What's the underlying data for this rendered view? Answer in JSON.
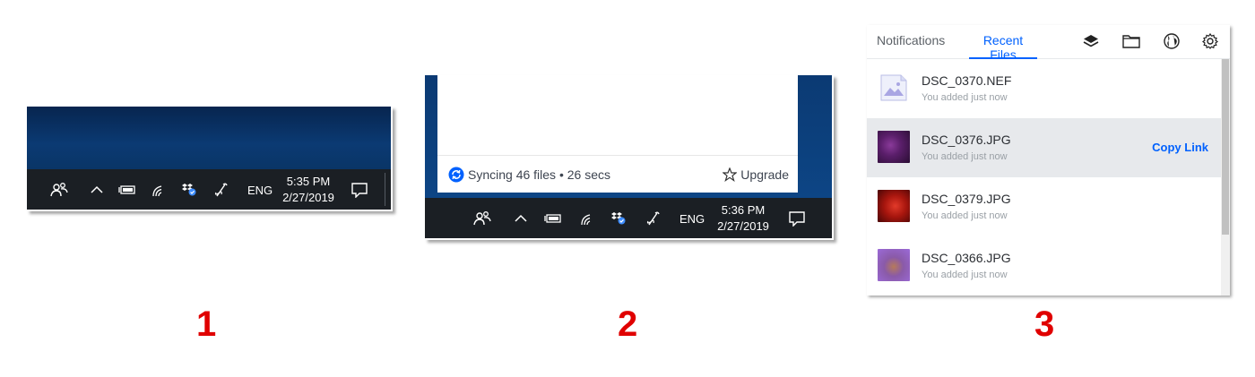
{
  "step_labels": [
    "1",
    "2",
    "3"
  ],
  "taskbar1": {
    "lang": "ENG",
    "time": "5:35 PM",
    "date": "2/27/2019"
  },
  "taskbar2": {
    "lang": "ENG",
    "time": "5:36 PM",
    "date": "2/27/2019"
  },
  "sync_popup": {
    "status": "Syncing 46 files • 26 secs",
    "upgrade_label": "Upgrade"
  },
  "dropbox_panel": {
    "tabs": [
      {
        "label": "Notifications",
        "active": false
      },
      {
        "label": "Recent Files",
        "active": true
      }
    ],
    "header_icons": [
      "layers-icon",
      "folder-icon",
      "globe-icon",
      "gear-icon"
    ],
    "files": [
      {
        "name": "DSC_0370.NEF",
        "subtitle": "You added just now"
      },
      {
        "name": "DSC_0376.JPG",
        "subtitle": "You added just now",
        "action": "Copy Link"
      },
      {
        "name": "DSC_0379.JPG",
        "subtitle": "You added just now"
      },
      {
        "name": "DSC_0366.JPG",
        "subtitle": "You added just now"
      }
    ]
  },
  "colors": {
    "accent": "#0061fe",
    "step_number": "#e00000",
    "taskbar": "#1b1f24"
  }
}
